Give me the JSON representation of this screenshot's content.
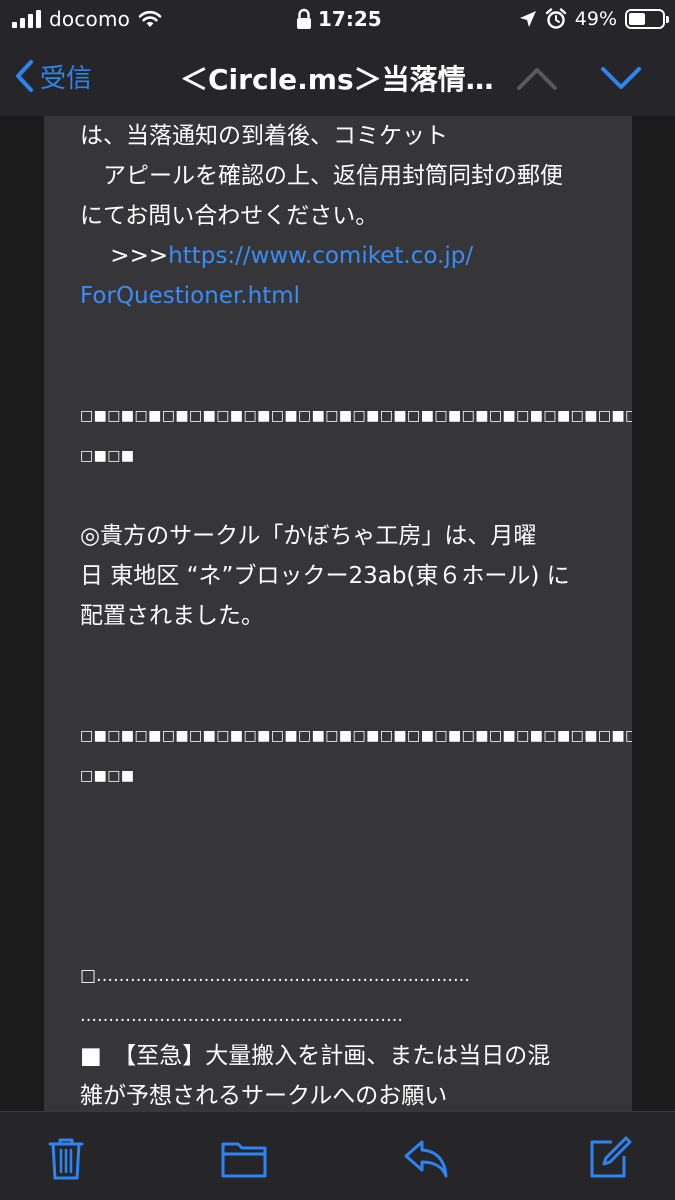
{
  "status_bar": {
    "carrier": "docomo",
    "time": "17:25",
    "battery_percent": "49%",
    "battery_level": 0.49
  },
  "nav": {
    "back_label": "受信",
    "title": "＜Circle.ms＞当落情…"
  },
  "mail": {
    "lines": [
      "は、当落通知の到着後、コミケット",
      "　アピールを確認の上、返信用封筒同封の郵便",
      "にてお問い合わせください。",
      "",
      "",
      "",
      "",
      "□■□■□■□■□■□■□■□■□■□■□■□■□■□■□■□■□■□■□■□■□■□■□■□■□■",
      "□■□■",
      "",
      "◎貴方のサークル「かぼちゃ工房」は、月曜",
      "日 東地区 “ネ”ブロックー23ab(東６ホール) に",
      "配置されました。",
      "",
      "",
      "□■□■□■□■□■□■□■□■□■□■□■□■□■□■□■□■□■□■□■□■□■□■□■□■□■",
      "□■□■",
      "",
      "",
      "",
      "",
      "□…………………………………………………………",
      "…………………………………………………",
      "■　【至急】大量搬入を計画、または当日の混",
      "雑が予想されるサークルへのお願い",
      "□…………………………………………………………",
      "…………………………………………………"
    ],
    "link_prefix": "　 >>>",
    "link_url_part1": "https://www.comiket.co.jp/",
    "link_url_part2": "ForQuestioner.html"
  },
  "toolbar": {
    "icons": [
      "trash-icon",
      "folder-icon",
      "reply-icon",
      "compose-icon"
    ]
  },
  "colors": {
    "accent": "#2d84f3",
    "link": "#3a8cf6",
    "bar_bg": "#262628",
    "card_bg": "#363638",
    "page_bg": "#1b1b1c"
  }
}
